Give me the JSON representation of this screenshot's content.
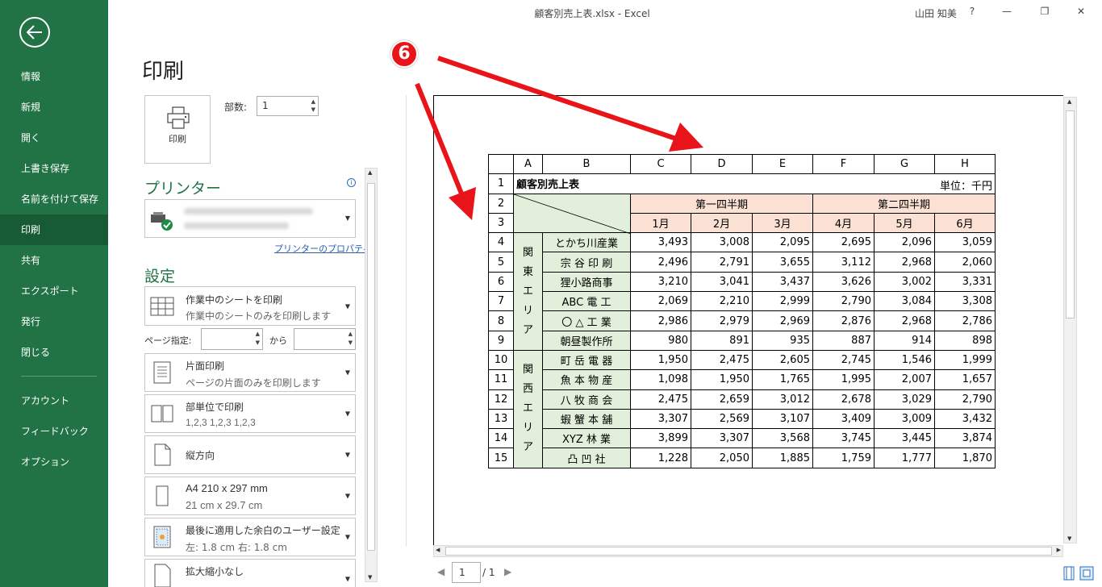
{
  "titlebar": {
    "doc_title": "顧客別売上表.xlsx  -  Excel",
    "user": "山田 知美",
    "help": "?"
  },
  "nav": [
    {
      "label": "情報",
      "active": false
    },
    {
      "label": "新規",
      "active": false
    },
    {
      "label": "開く",
      "active": false
    },
    {
      "label": "上書き保存",
      "active": false
    },
    {
      "label": "名前を付けて保存",
      "active": false
    },
    {
      "label": "印刷",
      "active": true
    },
    {
      "label": "共有",
      "active": false
    },
    {
      "label": "エクスポート",
      "active": false
    },
    {
      "label": "発行",
      "active": false
    },
    {
      "label": "閉じる",
      "active": false
    },
    {
      "label": "アカウント",
      "active": false
    },
    {
      "label": "フィードバック",
      "active": false
    },
    {
      "label": "オプション",
      "active": false
    }
  ],
  "print": {
    "title": "印刷",
    "print_button": "印刷",
    "copies_label": "部数:",
    "copies_value": "1",
    "printer_heading": "プリンター",
    "printer_properties": "プリンターのプロパティ",
    "settings_heading": "設定",
    "page_range_label": "ページ指定:",
    "page_range_to": "から"
  },
  "settings": {
    "what": {
      "title": "作業中のシートを印刷",
      "sub": "作業中のシートのみを印刷します"
    },
    "sides": {
      "title": "片面印刷",
      "sub": "ページの片面のみを印刷します"
    },
    "collate": {
      "title": "部単位で印刷",
      "sub": "1,2,3    1,2,3    1,2,3"
    },
    "orientation": {
      "title": "縦方向"
    },
    "paper": {
      "title": "A4 210 x 297 mm",
      "sub": "21 cm x 29.7 cm"
    },
    "margins": {
      "title": "最後に適用した余白のユーザー設定",
      "sub": "左:  1.8 cm    右:  1.8 cm"
    },
    "scaling": {
      "title": "拡大縮小なし"
    }
  },
  "sheet": {
    "col_headers": [
      "A",
      "B",
      "C",
      "D",
      "E",
      "F",
      "G",
      "H"
    ],
    "title": "顧客別売上表",
    "unit": "単位：千円",
    "q1": "第一四半期",
    "q2": "第二四半期",
    "months": [
      "1月",
      "2月",
      "3月",
      "4月",
      "5月",
      "6月"
    ],
    "area_kanto": [
      "関",
      "東",
      "エ",
      "リ",
      "ア"
    ],
    "area_kansai": [
      "関",
      "西",
      "エ",
      "リ",
      "ア"
    ],
    "rows": [
      {
        "n": "4",
        "name": "とかち川産業",
        "v": [
          "3,493",
          "3,008",
          "2,095",
          "2,695",
          "2,096",
          "3,059"
        ]
      },
      {
        "n": "5",
        "name": "宗 谷 印 刷",
        "v": [
          "2,496",
          "2,791",
          "3,655",
          "3,112",
          "2,968",
          "2,060"
        ]
      },
      {
        "n": "6",
        "name": "狸小路商事",
        "v": [
          "3,210",
          "3,041",
          "3,437",
          "3,626",
          "3,002",
          "3,331"
        ]
      },
      {
        "n": "7",
        "name": "ABC 電 工",
        "v": [
          "2,069",
          "2,210",
          "2,999",
          "2,790",
          "3,084",
          "3,308"
        ]
      },
      {
        "n": "8",
        "name": "〇 △ 工 業",
        "v": [
          "2,986",
          "2,979",
          "2,969",
          "2,876",
          "2,968",
          "2,786"
        ]
      },
      {
        "n": "9",
        "name": "朝昼製作所",
        "v": [
          "980",
          "891",
          "935",
          "887",
          "914",
          "898"
        ]
      },
      {
        "n": "10",
        "name": "町 岳 電 器",
        "v": [
          "1,950",
          "2,475",
          "2,605",
          "2,745",
          "1,546",
          "1,999"
        ]
      },
      {
        "n": "11",
        "name": "魚 本 物 産",
        "v": [
          "1,098",
          "1,950",
          "1,765",
          "1,995",
          "2,007",
          "1,657"
        ]
      },
      {
        "n": "12",
        "name": "八 牧 商 会",
        "v": [
          "2,475",
          "2,659",
          "3,012",
          "2,678",
          "3,029",
          "2,790"
        ]
      },
      {
        "n": "13",
        "name": "蝦 蟹 本 舗",
        "v": [
          "3,307",
          "2,569",
          "3,107",
          "3,409",
          "3,009",
          "3,432"
        ]
      },
      {
        "n": "14",
        "name": "XYZ 林 業",
        "v": [
          "3,899",
          "3,307",
          "3,568",
          "3,745",
          "3,445",
          "3,874"
        ]
      },
      {
        "n": "15",
        "name": "凸 凹 社",
        "v": [
          "1,228",
          "2,050",
          "1,885",
          "1,759",
          "1,777",
          "1,870"
        ]
      }
    ]
  },
  "pager": {
    "page": "1",
    "total": "/ 1"
  },
  "annotation": {
    "mark": "6",
    "color": "#e8141a"
  }
}
